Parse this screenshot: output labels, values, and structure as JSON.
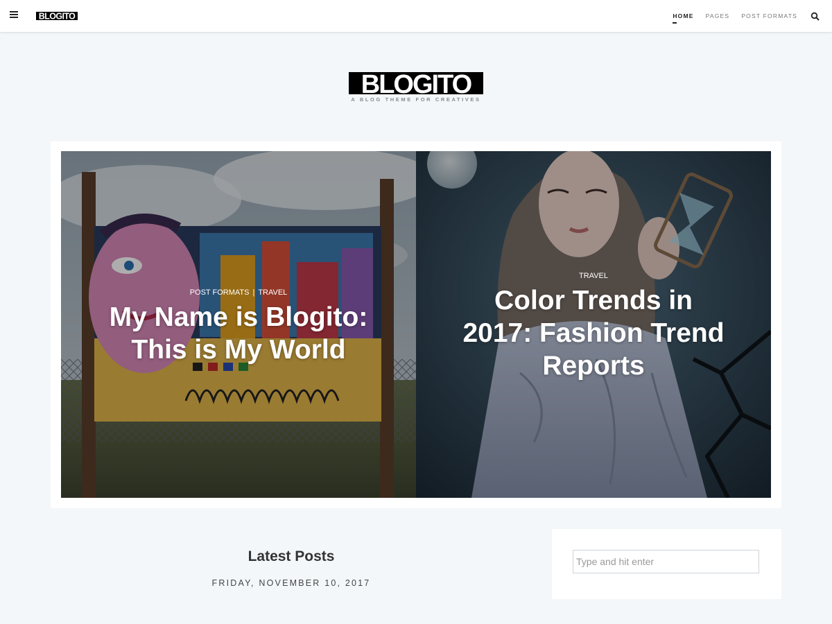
{
  "header": {
    "logo_text": "BLOGITO",
    "nav": [
      {
        "label": "HOME",
        "active": true
      },
      {
        "label": "PAGES",
        "active": false
      },
      {
        "label": "POST FORMATS",
        "active": false
      }
    ],
    "icons": {
      "menu": "hamburger-menu-icon",
      "search": "search-icon"
    }
  },
  "branding": {
    "title": "BLOGITO",
    "tagline": "A BLOG THEME FOR CREATIVES"
  },
  "featured": {
    "slides": [
      {
        "categories": [
          "POST FORMATS",
          "TRAVEL"
        ],
        "separator": "|",
        "title_lines": [
          "My Name is Blogito:",
          "This is My World"
        ]
      },
      {
        "categories": [
          "TRAVEL"
        ],
        "title_lines": [
          "Color Trends in",
          "2017: Fashion Trend",
          "Reports"
        ]
      }
    ]
  },
  "main": {
    "section_title": "Latest Posts",
    "date": "FRIDAY, NOVEMBER 10, 2017"
  },
  "sidebar": {
    "search_placeholder": "Type and hit enter"
  },
  "colors": {
    "page_bg": "#f4f7fa",
    "header_bg": "#ffffff",
    "text": "#333333"
  }
}
